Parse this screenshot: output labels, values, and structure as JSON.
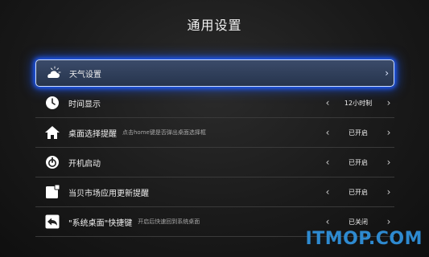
{
  "page": {
    "title": "通用设置"
  },
  "items": [
    {
      "label": "天气设置",
      "hint": "",
      "value": "",
      "icon": "weather-cloud-icon"
    },
    {
      "label": "时间显示",
      "hint": "",
      "value": "12小时制",
      "icon": "clock-icon"
    },
    {
      "label": "桌面选择提醒",
      "hint": "点击home键是否弹出桌面选择框",
      "value": "已开启",
      "icon": "home-icon"
    },
    {
      "label": "开机启动",
      "hint": "",
      "value": "已开启",
      "icon": "power-icon"
    },
    {
      "label": "当贝市场应用更新提醒",
      "hint": "",
      "value": "已开启",
      "icon": "update-badge-icon"
    },
    {
      "label": "\"系统桌面\"快捷键",
      "hint": "开启后快速回到系统桌面",
      "value": "已关闭",
      "icon": "back-arrow-icon"
    }
  ],
  "arrows": {
    "left": "‹",
    "right": "›"
  },
  "watermark": "ITMOP.COM"
}
